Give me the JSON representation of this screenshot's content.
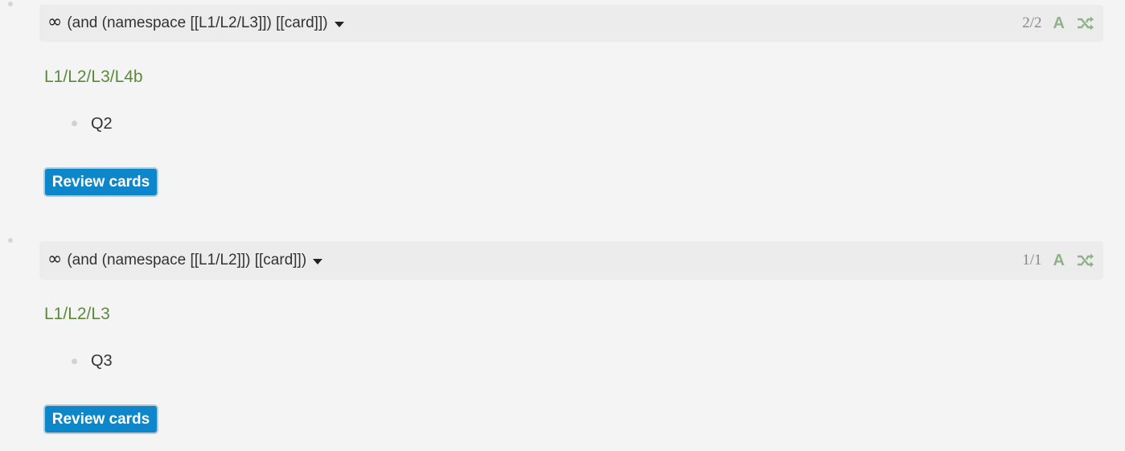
{
  "colors": {
    "background": "#f4f4f4",
    "header_bg": "#ececec",
    "link_green": "#5b8a3c",
    "icon_green": "#8fb28a",
    "button_blue": "#0d87c9"
  },
  "queries": [
    {
      "icon": "infinity-icon",
      "query": "(and (namespace [[L1/L2/L3]]) [[card]])",
      "count": "2/2",
      "a_label": "A",
      "page": "L1/L2/L3/L4b",
      "child": "Q2",
      "button": "Review cards"
    },
    {
      "icon": "infinity-icon",
      "query": "(and (namespace [[L1/L2]]) [[card]])",
      "count": "1/1",
      "a_label": "A",
      "page": "L1/L2/L3",
      "child": "Q3",
      "button": "Review cards"
    }
  ]
}
